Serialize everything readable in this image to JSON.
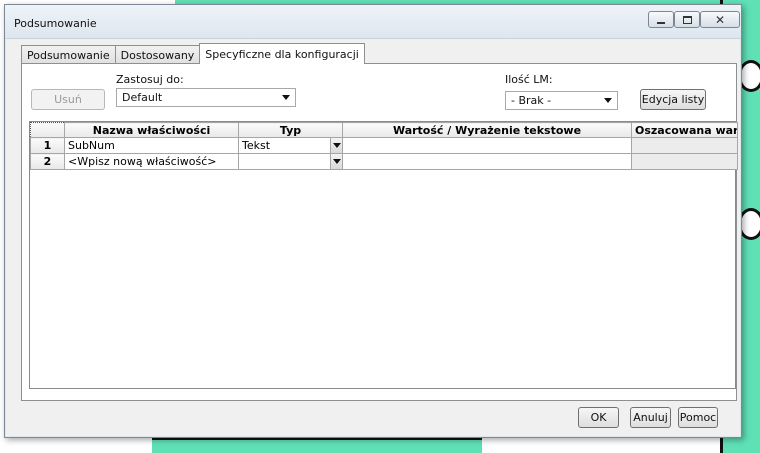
{
  "window": {
    "title": "Podsumowanie"
  },
  "tabs": [
    {
      "label": "Podsumowanie"
    },
    {
      "label": "Dostosowany"
    },
    {
      "label": "Specyficzne dla konfiguracji"
    }
  ],
  "controls": {
    "delete_label": "Usuń",
    "apply_to_label": "Zastosuj do:",
    "apply_to_value": "Default",
    "bom_qty_label": "Ilość LM:",
    "bom_qty_value": "- Brak -",
    "edit_list_label": "Edycja listy"
  },
  "table": {
    "columns": [
      "Nazwa właściwości",
      "Typ",
      "Wartość / Wyrażenie tekstowe",
      "Oszacowana wartość"
    ],
    "rows": [
      {
        "num": "1",
        "name": "SubNum",
        "type": "Tekst",
        "value": "",
        "evaluated": ""
      },
      {
        "num": "2",
        "name": "<Wpisz nową właściwość>",
        "type": "",
        "value": "",
        "evaluated": ""
      }
    ]
  },
  "footer": {
    "ok_label": "OK",
    "cancel_label": "Anuluj",
    "help_label": "Pomoc"
  },
  "colors": {
    "dialog_bg": "#f0f0f0",
    "background_app_accent": "#5fe0b5"
  }
}
